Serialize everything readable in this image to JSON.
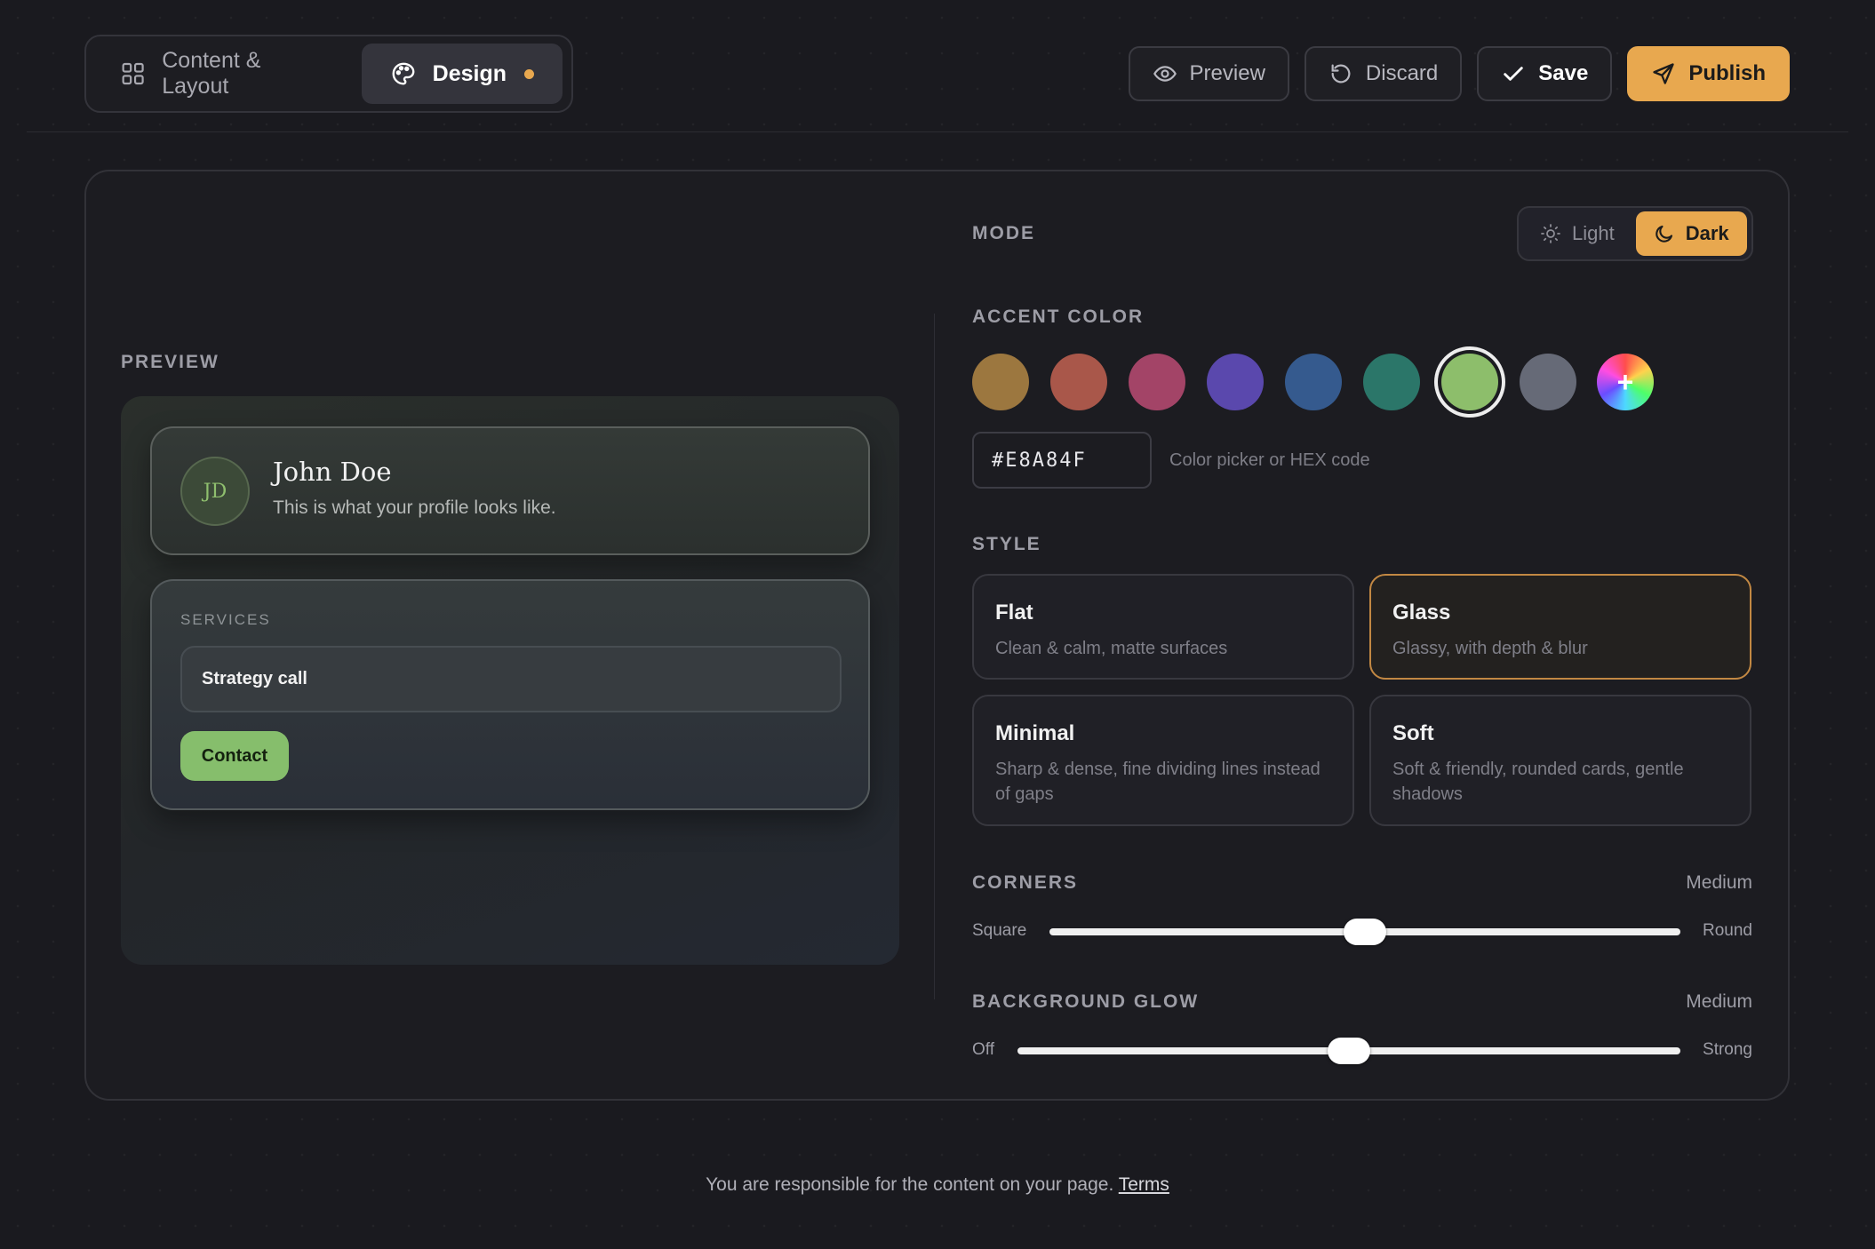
{
  "tabs": [
    {
      "label": "Content & Layout",
      "icon": "grid-icon",
      "active": false
    },
    {
      "label": "Design",
      "icon": "palette-icon",
      "active": true,
      "unsaved": true
    }
  ],
  "actions": {
    "preview": "Preview",
    "discard": "Discard",
    "save": "Save",
    "publish": "Publish"
  },
  "preview": {
    "label": "PREVIEW",
    "profile": {
      "initials": "JD",
      "name": "John Doe",
      "subtitle": "This is what your profile looks like."
    },
    "services": {
      "label": "SERVICES",
      "items": [
        "Strategy call"
      ],
      "contact_label": "Contact"
    }
  },
  "mode": {
    "label": "MODE",
    "options": [
      {
        "label": "Light",
        "icon": "sun-icon",
        "active": false
      },
      {
        "label": "Dark",
        "icon": "moon-icon",
        "active": true
      }
    ]
  },
  "accent": {
    "label": "ACCENT COLOR",
    "swatches": [
      "#9c773f",
      "#a9574a",
      "#a34467",
      "#5a48ad",
      "#355a8e",
      "#2b7669",
      "#8dbe6b",
      "#666a77"
    ],
    "selected_index": 6,
    "custom_symbol": "+",
    "hex_value": "#E8A84F",
    "hex_hint": "Color picker or HEX code"
  },
  "style": {
    "label": "STYLE",
    "options": [
      {
        "title": "Flat",
        "desc": "Clean & calm, matte surfaces",
        "selected": false
      },
      {
        "title": "Glass",
        "desc": "Glassy, with depth & blur",
        "selected": true
      },
      {
        "title": "Minimal",
        "desc": "Sharp & dense, fine dividing lines instead of gaps",
        "selected": false
      },
      {
        "title": "Soft",
        "desc": "Soft & friendly, rounded cards, gentle shadows",
        "selected": false
      }
    ]
  },
  "corners": {
    "label": "CORNERS",
    "value_label": "Medium",
    "min_label": "Square",
    "max_label": "Round",
    "value": 0.5
  },
  "glow": {
    "label": "BACKGROUND GLOW",
    "value_label": "Medium",
    "min_label": "Off",
    "max_label": "Strong",
    "value": 0.5
  },
  "footer": {
    "text": "You are responsible for the content on your page.",
    "link": "Terms"
  },
  "colors": {
    "brand": "#e8a84f",
    "background": "#1a1a1f",
    "contact_button": "#86be6c"
  }
}
